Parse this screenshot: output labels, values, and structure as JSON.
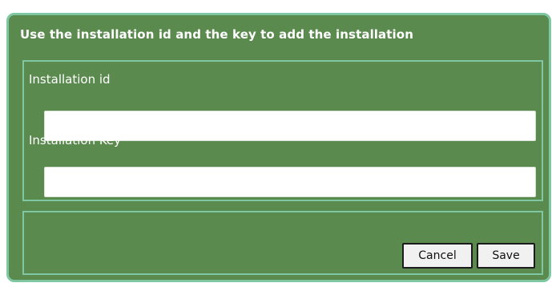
{
  "dialog": {
    "title": "Use the installation id and the key to add the installation"
  },
  "form": {
    "installation_id": {
      "label": "Installation id",
      "value": ""
    },
    "installation_key": {
      "label": "Installation Key",
      "value": ""
    }
  },
  "buttons": {
    "cancel": "Cancel",
    "save": "Save"
  },
  "colors": {
    "dialog_background": "#5b8a4f",
    "panel_border": "#7fc6a2",
    "text": "#ffffff"
  }
}
